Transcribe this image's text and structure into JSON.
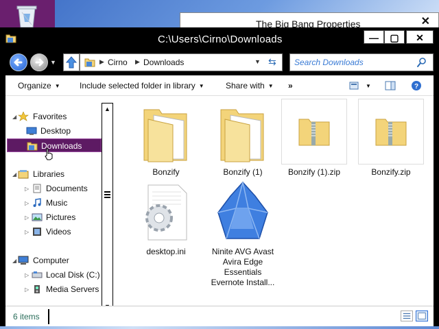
{
  "window": {
    "title": "C:\\Users\\Cirno\\Downloads",
    "minimize_label": "—",
    "maximize_label": "▢",
    "close_label": "✕"
  },
  "background_window": {
    "title": "The Big Bang Properties",
    "close_label": "✕"
  },
  "address": {
    "crumbs": [
      "Cirno",
      "Downloads"
    ]
  },
  "search": {
    "placeholder": "Search Downloads"
  },
  "toolbar": {
    "organize": "Organize",
    "include": "Include selected folder in library",
    "share": "Share with",
    "more": "»"
  },
  "sidebar": {
    "favorites": {
      "label": "Favorites",
      "items": [
        "Desktop",
        "Downloads"
      ]
    },
    "libraries": {
      "label": "Libraries",
      "items": [
        "Documents",
        "Music",
        "Pictures",
        "Videos"
      ]
    },
    "computer": {
      "label": "Computer",
      "items": [
        "Local Disk (C:)",
        "Media Servers"
      ]
    },
    "selected": "Downloads"
  },
  "files": [
    {
      "name": "Bonzify",
      "type": "folder"
    },
    {
      "name": "Bonzify (1)",
      "type": "folder"
    },
    {
      "name": "Bonzify (1).zip",
      "type": "zip"
    },
    {
      "name": "Bonzify.zip",
      "type": "zip"
    },
    {
      "name": "desktop.ini",
      "type": "ini"
    },
    {
      "name": "Ninite AVG Avast Avira Edge Essentials Evernote Install...",
      "name_lines": [
        "Ninite AVG Avast",
        "Avira Edge",
        "Essentials",
        "Evernote Install..."
      ],
      "type": "exe"
    }
  ],
  "status": {
    "count": "6 items"
  },
  "colors": {
    "selection": "#5d1a63",
    "accent_blue": "#3a7bd5",
    "folder_yellow": "#f3d47a"
  }
}
